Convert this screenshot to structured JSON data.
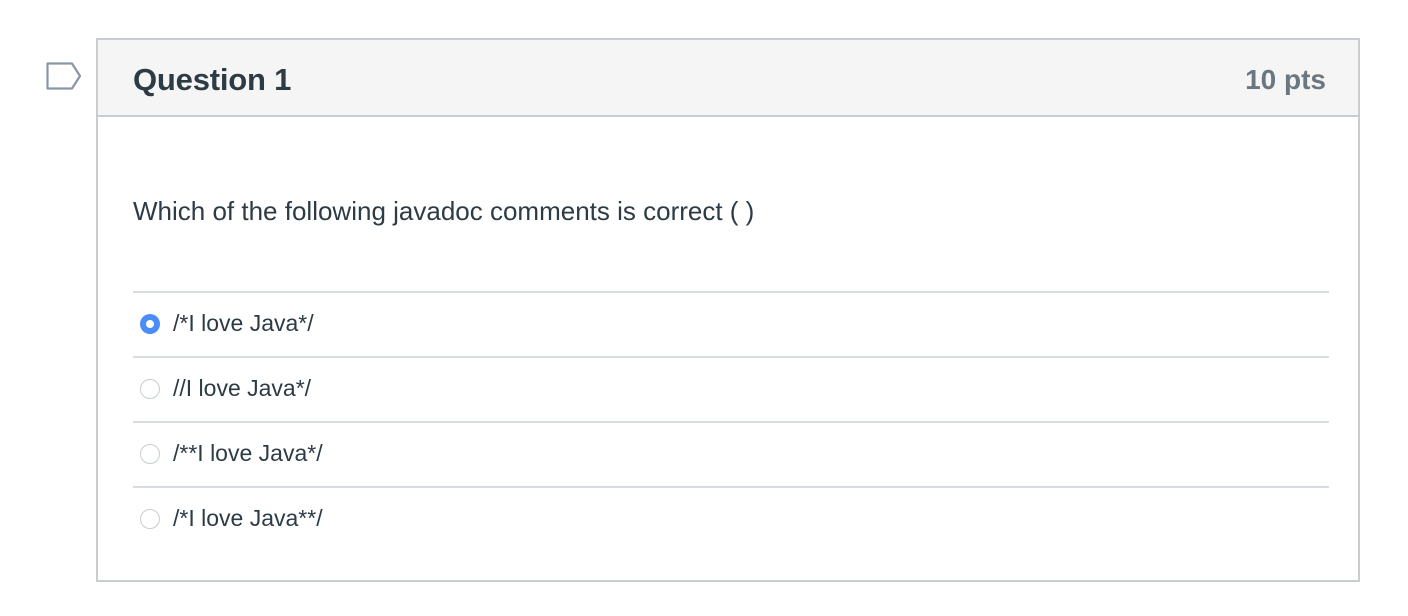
{
  "question": {
    "title": "Question 1",
    "points": "10 pts",
    "text": "Which of the following javadoc comments is correct ( )",
    "flag_icon": "flag-outline-icon",
    "answers": [
      {
        "label": "/*I love Java*/",
        "selected": true
      },
      {
        "label": "//I love Java*/",
        "selected": false
      },
      {
        "label": "/**I love Java*/",
        "selected": false
      },
      {
        "label": "/*I love Java**/",
        "selected": false
      }
    ]
  },
  "colors": {
    "accent": "#4a8df8",
    "border": "#c7cdd1",
    "header_bg": "#f5f5f5",
    "text": "#2d3b45",
    "points_text": "#6b7780"
  }
}
